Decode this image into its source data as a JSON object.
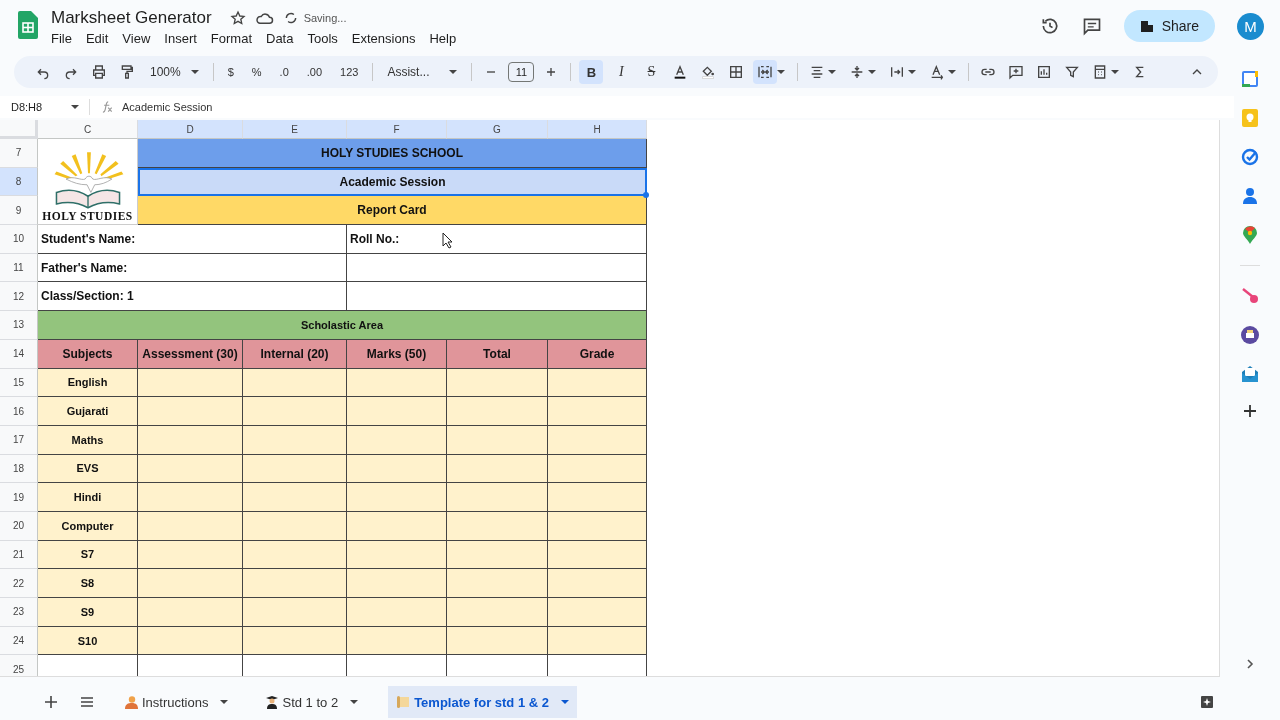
{
  "app": {
    "title": "Marksheet Generator",
    "status": "Saving...",
    "menu": [
      "File",
      "Edit",
      "View",
      "Insert",
      "Format",
      "Data",
      "Tools",
      "Extensions",
      "Help"
    ],
    "share": "Share",
    "avatar": "M"
  },
  "toolbar": {
    "zoom": "100%",
    "number_formats": [
      "$",
      "%",
      ".0",
      ".00",
      "123"
    ],
    "font": "Assist...",
    "font_size": "11",
    "text_styles": [
      {
        "label": "B",
        "kind": "bold",
        "selected": true
      },
      {
        "label": "I",
        "kind": "italic",
        "selected": false
      },
      {
        "label": "S",
        "kind": "strike",
        "selected": false
      }
    ],
    "merge": {
      "selected": true
    }
  },
  "formula_bar": {
    "name_box": "D8:H8",
    "value": "Academic Session"
  },
  "sheet": {
    "columns": [
      {
        "label": "C",
        "selected": false
      },
      {
        "label": "D",
        "selected": true
      },
      {
        "label": "E",
        "selected": true
      },
      {
        "label": "F",
        "selected": true
      },
      {
        "label": "G",
        "selected": true
      },
      {
        "label": "H",
        "selected": true
      }
    ],
    "rows": [
      {
        "label": "7",
        "selected": false
      },
      {
        "label": "8",
        "selected": true
      },
      {
        "label": "9",
        "selected": false
      },
      {
        "label": "10",
        "selected": false
      },
      {
        "label": "11",
        "selected": false
      },
      {
        "label": "12",
        "selected": false
      },
      {
        "label": "13",
        "selected": false
      },
      {
        "label": "14",
        "selected": false
      },
      {
        "label": "15",
        "selected": false
      },
      {
        "label": "16",
        "selected": false
      },
      {
        "label": "17",
        "selected": false
      },
      {
        "label": "18",
        "selected": false
      },
      {
        "label": "19",
        "selected": false
      },
      {
        "label": "20",
        "selected": false
      },
      {
        "label": "21",
        "selected": false
      },
      {
        "label": "22",
        "selected": false
      },
      {
        "label": "23",
        "selected": false
      },
      {
        "label": "24",
        "selected": false
      },
      {
        "label": "25",
        "selected": false
      }
    ],
    "logo_text": "HOLY STUDIES",
    "title": "HOLY STUDIES SCHOOL",
    "session": {
      "text": "Academic Session",
      "selected": true
    },
    "report": "Report Card",
    "info": [
      {
        "left": "Student's Name:",
        "right": "Roll No.:"
      },
      {
        "left": "Father's Name:"
      },
      {
        "left": "Class/Section: 1"
      }
    ],
    "section": "Scholastic Area",
    "headers": [
      "Subjects",
      "Assessment (30)",
      "Internal (20)",
      "Marks (50)",
      "Total",
      "Grade"
    ],
    "subjects": [
      "English",
      "Gujarati",
      "Maths",
      "EVS",
      "Hindi",
      "Computer",
      "S7",
      "S8",
      "S9",
      "S10"
    ]
  },
  "sheet_tabs": [
    {
      "label": "Instructions",
      "kind": "person",
      "selected": false
    },
    {
      "label": "Std 1 to 2",
      "kind": "graduate",
      "selected": false
    },
    {
      "label": "Template for std 1 & 2",
      "kind": "scroll",
      "selected": true
    }
  ]
}
